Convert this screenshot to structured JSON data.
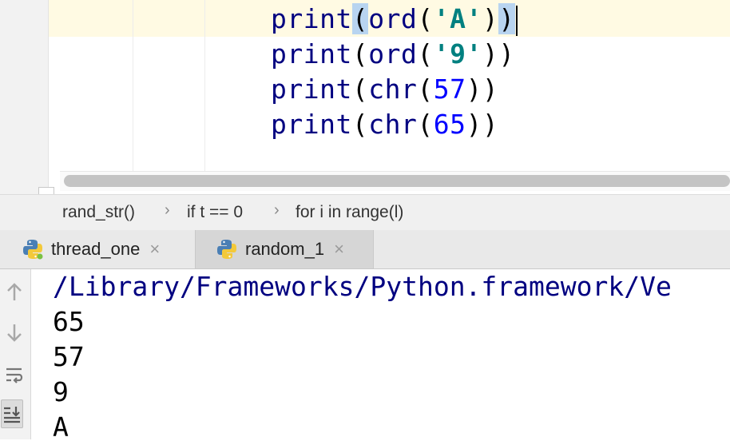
{
  "editor": {
    "code_lines": [
      {
        "fn": "print",
        "open": "(",
        "inner_fn": "ord",
        "inner_open": "(",
        "arg": "'A'",
        "arg_type": "str",
        "inner_close": ")",
        "close": ")"
      },
      {
        "fn": "print",
        "open": "(",
        "inner_fn": "ord",
        "inner_open": "(",
        "arg": "'9'",
        "arg_type": "str",
        "inner_close": ")",
        "close": ")"
      },
      {
        "fn": "print",
        "open": "(",
        "inner_fn": "chr",
        "inner_open": "(",
        "arg": "57",
        "arg_type": "num",
        "inner_close": ")",
        "close": ")"
      },
      {
        "fn": "print",
        "open": "(",
        "inner_fn": "chr",
        "inner_open": "(",
        "arg": "65",
        "arg_type": "num",
        "inner_close": ")",
        "close": ")"
      }
    ]
  },
  "breadcrumb": {
    "items": [
      "rand_str()",
      "if t == 0",
      "for i in range(l)"
    ],
    "separator": "›"
  },
  "tabs": [
    {
      "label": "thread_one",
      "icon": "python-icon",
      "close": "×",
      "active": false
    },
    {
      "label": "random_1",
      "icon": "python-icon",
      "close": "×",
      "active": true
    }
  ],
  "console": {
    "lines": [
      "/Library/Frameworks/Python.framework/Ve",
      "65",
      "57",
      "9",
      "A"
    ],
    "toolbar_icons": [
      "up-arrow-icon",
      "down-arrow-icon",
      "soft-wrap-icon",
      "scroll-to-end-icon"
    ]
  },
  "colors": {
    "current_line": "#fffae3",
    "keyword_fn": "#000080",
    "string": "#008080",
    "number": "#0000ff",
    "brace_highlight": "#b8d4f0"
  }
}
